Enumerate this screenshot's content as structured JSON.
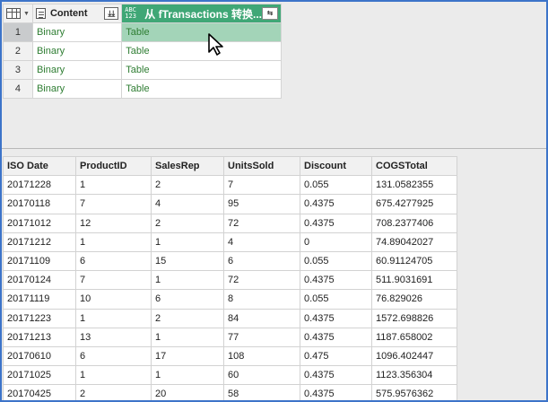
{
  "top_grid": {
    "columns": [
      {
        "name": "Content",
        "type_icon": "list-icon"
      },
      {
        "name": "从 fTransactions 转换...",
        "type_icon": "abc-123-icon",
        "type_label_top": "ABC",
        "type_label_bottom": "123"
      }
    ],
    "rows": [
      {
        "index": "1",
        "content": "Binary",
        "result": "Table"
      },
      {
        "index": "2",
        "content": "Binary",
        "result": "Table"
      },
      {
        "index": "3",
        "content": "Binary",
        "result": "Table"
      },
      {
        "index": "4",
        "content": "Binary",
        "result": "Table"
      }
    ],
    "selected_row": 0,
    "accent_color": "#3fa776",
    "selected_cell_color": "#a3d4b8"
  },
  "preview_table": {
    "headers": [
      "ISO Date",
      "ProductID",
      "SalesRep",
      "UnitsSold",
      "Discount",
      "COGSTotal"
    ],
    "rows": [
      [
        "20171228",
        "1",
        "2",
        "7",
        "0.055",
        "131.0582355"
      ],
      [
        "20170118",
        "7",
        "4",
        "95",
        "0.4375",
        "675.4277925"
      ],
      [
        "20171012",
        "12",
        "2",
        "72",
        "0.4375",
        "708.2377406"
      ],
      [
        "20171212",
        "1",
        "1",
        "4",
        "0",
        "74.89042027"
      ],
      [
        "20171109",
        "6",
        "15",
        "6",
        "0.055",
        "60.91124705"
      ],
      [
        "20170124",
        "7",
        "1",
        "72",
        "0.4375",
        "511.9031691"
      ],
      [
        "20171119",
        "10",
        "6",
        "8",
        "0.055",
        "76.829026"
      ],
      [
        "20171223",
        "1",
        "2",
        "84",
        "0.4375",
        "1572.698826"
      ],
      [
        "20171213",
        "13",
        "1",
        "77",
        "0.4375",
        "1187.658002"
      ],
      [
        "20170610",
        "6",
        "17",
        "108",
        "0.475",
        "1096.402447"
      ],
      [
        "20171025",
        "1",
        "1",
        "60",
        "0.4375",
        "1123.356304"
      ],
      [
        "20170425",
        "2",
        "20",
        "58",
        "0.4375",
        "575.9576362"
      ]
    ]
  }
}
